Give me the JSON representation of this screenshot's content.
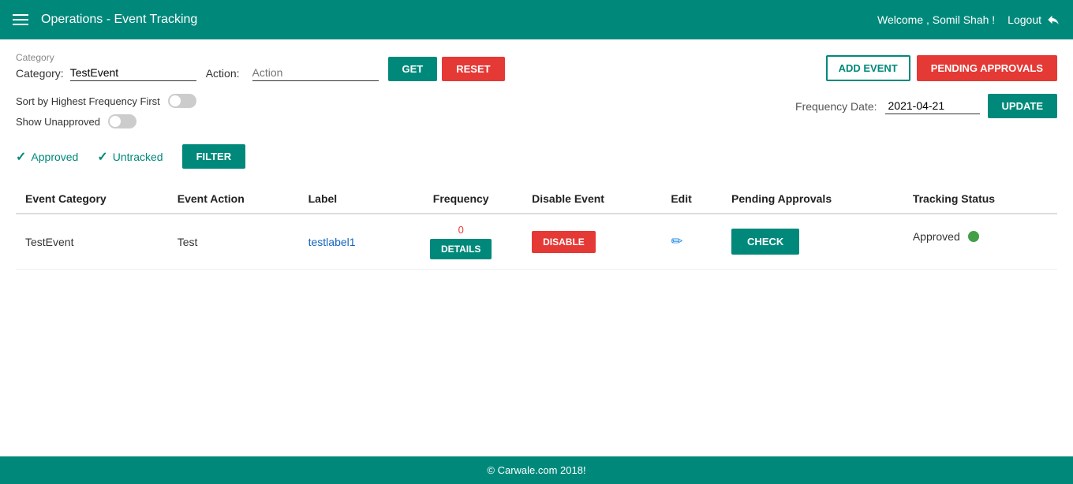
{
  "header": {
    "hamburger_label": "menu",
    "title": "Operations - Event Tracking",
    "welcome": "Welcome , Somil Shah !",
    "logout_label": "Logout"
  },
  "controls": {
    "category_label": "Category:",
    "category_field_label": "Category",
    "category_value": "TestEvent",
    "action_label": "Action:",
    "action_placeholder": "Action",
    "get_label": "GET",
    "reset_label": "RESET",
    "add_event_label": "ADD EVENT",
    "pending_approvals_label": "PENDING APPROVALS"
  },
  "toggles": {
    "sort_label": "Sort by Highest Frequency First",
    "show_unapproved_label": "Show Unapproved"
  },
  "frequency": {
    "label": "Frequency Date:",
    "value": "2021-04-21",
    "update_label": "UPDATE"
  },
  "legend": {
    "approved_label": "Approved",
    "untracked_label": "Untracked",
    "filter_label": "FILTER"
  },
  "table": {
    "headers": [
      "Event Category",
      "Event Action",
      "Label",
      "Frequency",
      "Disable Event",
      "Edit",
      "Pending Approvals",
      "Tracking Status"
    ],
    "rows": [
      {
        "event_category": "TestEvent",
        "event_action": "Test",
        "label": "testlabel1",
        "frequency_count": "0",
        "frequency_btn": "DETAILS",
        "disable_btn": "DISABLE",
        "check_btn": "CHECK",
        "tracking_status": "Approved"
      }
    ]
  },
  "footer": {
    "text": "© Carwale.com 2018!"
  }
}
